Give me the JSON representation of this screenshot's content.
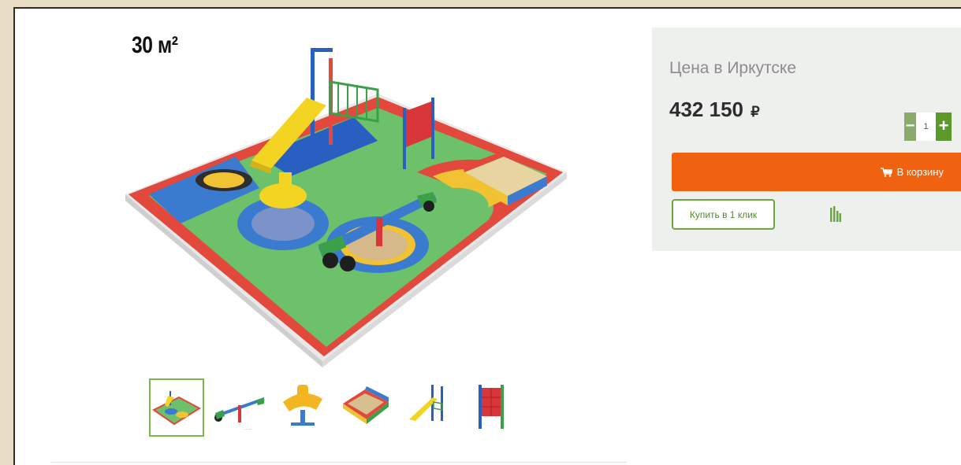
{
  "product": {
    "area_label": "30 м²",
    "gallery_thumbnail_count": 6
  },
  "pricing": {
    "city_label": "Цена в Иркутске",
    "price": "432 150",
    "currency": "₽",
    "quantity": "1",
    "minus_label": "−",
    "plus_label": "+"
  },
  "actions": {
    "cart_label": "В корзину",
    "one_click_label": "Купить в 1 клик"
  },
  "icons": {
    "cart": "cart-icon",
    "compare": "compare-bars-icon"
  },
  "colors": {
    "accent_orange": "#f06210",
    "accent_green": "#5b9a2a",
    "panel_bg": "#eef0ee"
  }
}
